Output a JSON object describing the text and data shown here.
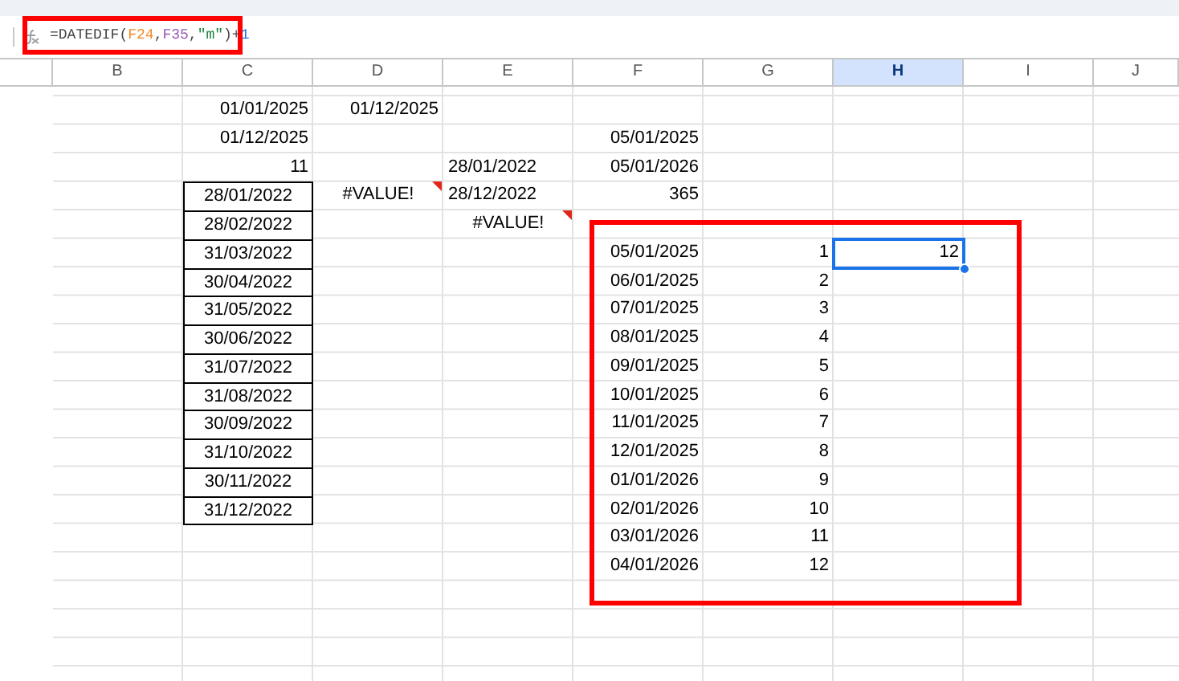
{
  "formula_bar": {
    "tokens": [
      {
        "text": "=DATEDIF(",
        "color": "#444444"
      },
      {
        "text": "F24",
        "color": "#f08a24"
      },
      {
        "text": ",",
        "color": "#444444"
      },
      {
        "text": "F35",
        "color": "#9b59b6"
      },
      {
        "text": ",",
        "color": "#444444"
      },
      {
        "text": "\"m\"",
        "color": "#188038"
      },
      {
        "text": ")+",
        "color": "#444444"
      },
      {
        "text": "1",
        "color": "#1a73e8"
      }
    ]
  },
  "columns": [
    {
      "label": "B",
      "selected": false
    },
    {
      "label": "C",
      "selected": false
    },
    {
      "label": "D",
      "selected": false
    },
    {
      "label": "E",
      "selected": false
    },
    {
      "label": "F",
      "selected": false
    },
    {
      "label": "G",
      "selected": false
    },
    {
      "label": "H",
      "selected": true
    },
    {
      "label": "I",
      "selected": false
    },
    {
      "label": "J",
      "selected": false
    }
  ],
  "rows": [
    {
      "c": "01/01/2025",
      "d": "01/12/2025"
    },
    {
      "c": "01/12/2025",
      "f": "05/01/2025"
    },
    {
      "c": "11",
      "e": {
        "kind": "text",
        "text": "28/01/2022"
      },
      "f": "05/01/2026"
    },
    {
      "c": {
        "kind": "boxed",
        "text": "28/01/2022"
      },
      "d": {
        "kind": "error",
        "text": "#VALUE!"
      },
      "e": {
        "kind": "text",
        "text": "28/12/2022"
      },
      "f": "365"
    },
    {
      "c": {
        "kind": "boxed",
        "text": "28/02/2022"
      },
      "e": {
        "kind": "error",
        "text": "#VALUE!"
      }
    },
    {
      "c": {
        "kind": "boxed",
        "text": "31/03/2022"
      },
      "f": "05/01/2025",
      "g": "1",
      "h": {
        "kind": "number",
        "text": "12",
        "selected": true
      }
    },
    {
      "c": {
        "kind": "boxed",
        "text": "30/04/2022"
      },
      "f": "06/01/2025",
      "g": "2"
    },
    {
      "c": {
        "kind": "boxed",
        "text": "31/05/2022"
      },
      "f": "07/01/2025",
      "g": "3"
    },
    {
      "c": {
        "kind": "boxed",
        "text": "30/06/2022"
      },
      "f": "08/01/2025",
      "g": "4"
    },
    {
      "c": {
        "kind": "boxed",
        "text": "31/07/2022"
      },
      "f": "09/01/2025",
      "g": "5"
    },
    {
      "c": {
        "kind": "boxed",
        "text": "31/08/2022"
      },
      "f": "10/01/2025",
      "g": "6"
    },
    {
      "c": {
        "kind": "boxed",
        "text": "30/09/2022"
      },
      "f": "11/01/2025",
      "g": "7"
    },
    {
      "c": {
        "kind": "boxed",
        "text": "31/10/2022"
      },
      "f": "12/01/2025",
      "g": "8"
    },
    {
      "c": {
        "kind": "boxed",
        "text": "30/11/2022"
      },
      "f": "01/01/2026",
      "g": "9"
    },
    {
      "c": {
        "kind": "boxed",
        "text": "31/12/2022"
      },
      "f": "02/01/2026",
      "g": "10"
    },
    {
      "f": "03/01/2026",
      "g": "11"
    },
    {
      "f": "04/01/2026",
      "g": "12"
    }
  ]
}
